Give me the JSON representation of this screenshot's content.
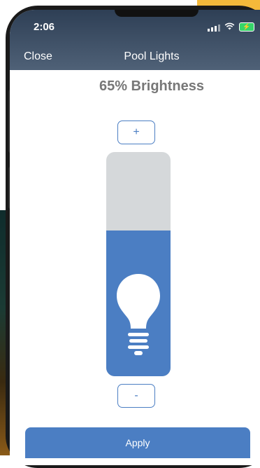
{
  "status_bar": {
    "time": "2:06"
  },
  "nav": {
    "close_label": "Close",
    "title": "Pool Lights"
  },
  "brightness": {
    "text": "65% Brightness",
    "level": 0.65
  },
  "controls": {
    "plus_label": "+",
    "minus_label": "-",
    "apply_label": "Apply"
  },
  "colors": {
    "accent": "#4b7ec3",
    "header_top": "#2e3f55",
    "header_bottom": "#4f6177",
    "track": "#d5d8da",
    "text_gray": "#777777"
  }
}
